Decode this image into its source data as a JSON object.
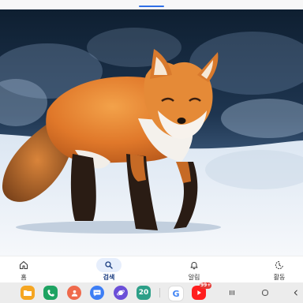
{
  "nav": {
    "items": [
      {
        "label": "홈",
        "icon": "home-icon",
        "active": false
      },
      {
        "label": "검색",
        "icon": "search-icon",
        "active": true
      },
      {
        "label": "알림",
        "icon": "bell-icon",
        "active": false
      },
      {
        "label": "활동",
        "icon": "activity-icon",
        "active": false
      }
    ],
    "active_color": "#1a3c80",
    "active_bg": "#e6eefc"
  },
  "taskbar": {
    "apps": [
      {
        "name": "folder-app-icon",
        "color": "#f5a623"
      },
      {
        "name": "phone-app-icon",
        "color": "#1ea362"
      },
      {
        "name": "contacts-app-icon",
        "color": "#ef6a4c"
      },
      {
        "name": "messages-app-icon",
        "color": "#3d7ef5"
      },
      {
        "name": "internet-app-icon",
        "color": "#6b4fd8"
      },
      {
        "name": "calendar-app-icon",
        "color": "#2c9f88",
        "text": "20"
      },
      {
        "name": "google-app-icon",
        "color": "#ffffff",
        "text": "G"
      },
      {
        "name": "youtube-app-icon",
        "color": "#ff1e1e",
        "badge": "99+"
      }
    ]
  },
  "top_indicator_color": "#2f6fe6"
}
